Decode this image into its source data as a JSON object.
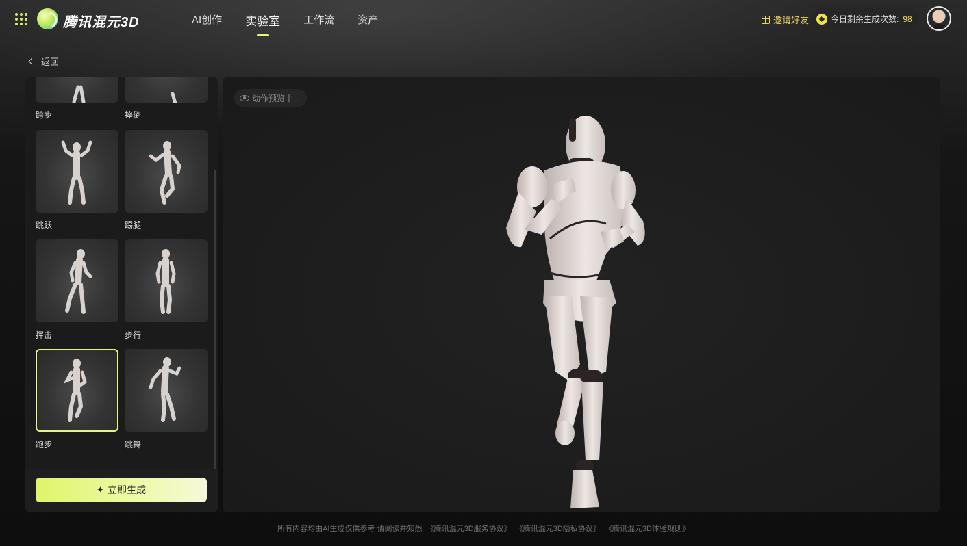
{
  "header": {
    "logo_text": "腾讯混元3D",
    "nav": [
      {
        "label": "AI创作",
        "active": false
      },
      {
        "label": "实验室",
        "active": true
      },
      {
        "label": "工作流",
        "active": false
      },
      {
        "label": "资产",
        "active": false
      }
    ],
    "invite_label": "邀请好友",
    "credits_label": "今日剩余生成次数:",
    "credits_value": "98",
    "accent_color": "#e6f86a"
  },
  "back_label": "返回",
  "motion_list": {
    "items": [
      {
        "label": "跨步",
        "selected": false
      },
      {
        "label": "摔倒",
        "selected": false
      },
      {
        "label": "跳跃",
        "selected": false
      },
      {
        "label": "踢腿",
        "selected": false
      },
      {
        "label": "挥击",
        "selected": false
      },
      {
        "label": "步行",
        "selected": false
      },
      {
        "label": "跑步",
        "selected": true
      },
      {
        "label": "跳舞",
        "selected": false
      }
    ]
  },
  "generate_button": {
    "label": "立即生成",
    "icon": "sparkle-icon"
  },
  "preview": {
    "status_badge": "动作预览中..."
  },
  "footer": {
    "text": "所有内容均由AI生成仅供参考 请阅读并知悉",
    "links": [
      "《腾讯混元3D服务协议》",
      "《腾讯混元3D隐私协议》",
      "《腾讯混元3D体验规则》"
    ]
  }
}
